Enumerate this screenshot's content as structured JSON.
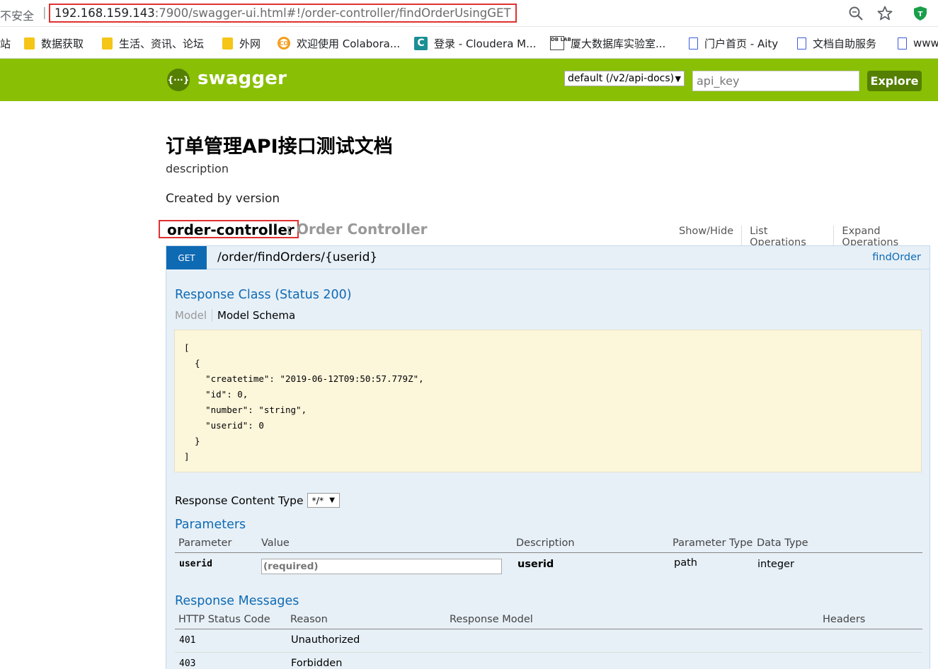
{
  "browser": {
    "security_label": "不安全",
    "separator": "|",
    "url_host": "192.168.159.143",
    "url_rest": ":7900/swagger-ui.html#!/order-controller/findOrderUsingGET"
  },
  "bookmarks": [
    {
      "label": "站",
      "icon": "none"
    },
    {
      "label": "数据获取",
      "icon": "folder-icon"
    },
    {
      "label": "生活、资讯、论坛",
      "icon": "folder-icon"
    },
    {
      "label": "外网",
      "icon": "folder-icon"
    },
    {
      "label": "欢迎使用 Colabora...",
      "icon": "colab-icon",
      "glyph": "CO"
    },
    {
      "label": "登录 - Cloudera M...",
      "icon": "cloudera-icon",
      "glyph": "C"
    },
    {
      "label": "厦大数据库实验室...",
      "icon": "dblab-icon",
      "glyph": "DB LAB"
    },
    {
      "label": "门户首页 - Aity",
      "icon": "page-icon"
    },
    {
      "label": "文档自助服务",
      "icon": "page-icon"
    },
    {
      "label": "www",
      "icon": "page-icon"
    }
  ],
  "swagger": {
    "logo_glyph": "{···}",
    "logo_text": "swagger",
    "spec_selected": "default (/v2/api-docs)",
    "api_key_placeholder": "api_key",
    "explore_label": "Explore",
    "brand_color": "#89bf04"
  },
  "info": {
    "title": "订单管理API接口测试文档",
    "description": "description",
    "created_by": "Created by version"
  },
  "resource": {
    "name": "order-controller",
    "description": ": Order Controller",
    "links": [
      "Show/Hide",
      "List Operations",
      "Expand Operations"
    ]
  },
  "operation": {
    "method": "GET",
    "path": "/order/findOrders/{userid}",
    "nickname": "findOrder",
    "response_class_heading": "Response Class (Status 200)",
    "tabs": [
      "Model",
      "Model Schema"
    ],
    "schema": "[\n  {\n    \"createtime\": \"2019-06-12T09:50:57.779Z\",\n    \"id\": 0,\n    \"number\": \"string\",\n    \"userid\": 0\n  }\n]",
    "content_type_label": "Response Content Type",
    "content_type_value": "*/*",
    "parameters_heading": "Parameters",
    "param_headers": [
      "Parameter",
      "Value",
      "Description",
      "Parameter Type",
      "Data Type"
    ],
    "params": [
      {
        "name": "userid",
        "placeholder": "(required)",
        "description": "userid",
        "param_type": "path",
        "data_type": "integer"
      }
    ],
    "messages_heading": "Response Messages",
    "message_headers": [
      "HTTP Status Code",
      "Reason",
      "Response Model",
      "Headers"
    ],
    "messages": [
      {
        "code": "401",
        "reason": "Unauthorized"
      },
      {
        "code": "403",
        "reason": "Forbidden"
      }
    ]
  }
}
